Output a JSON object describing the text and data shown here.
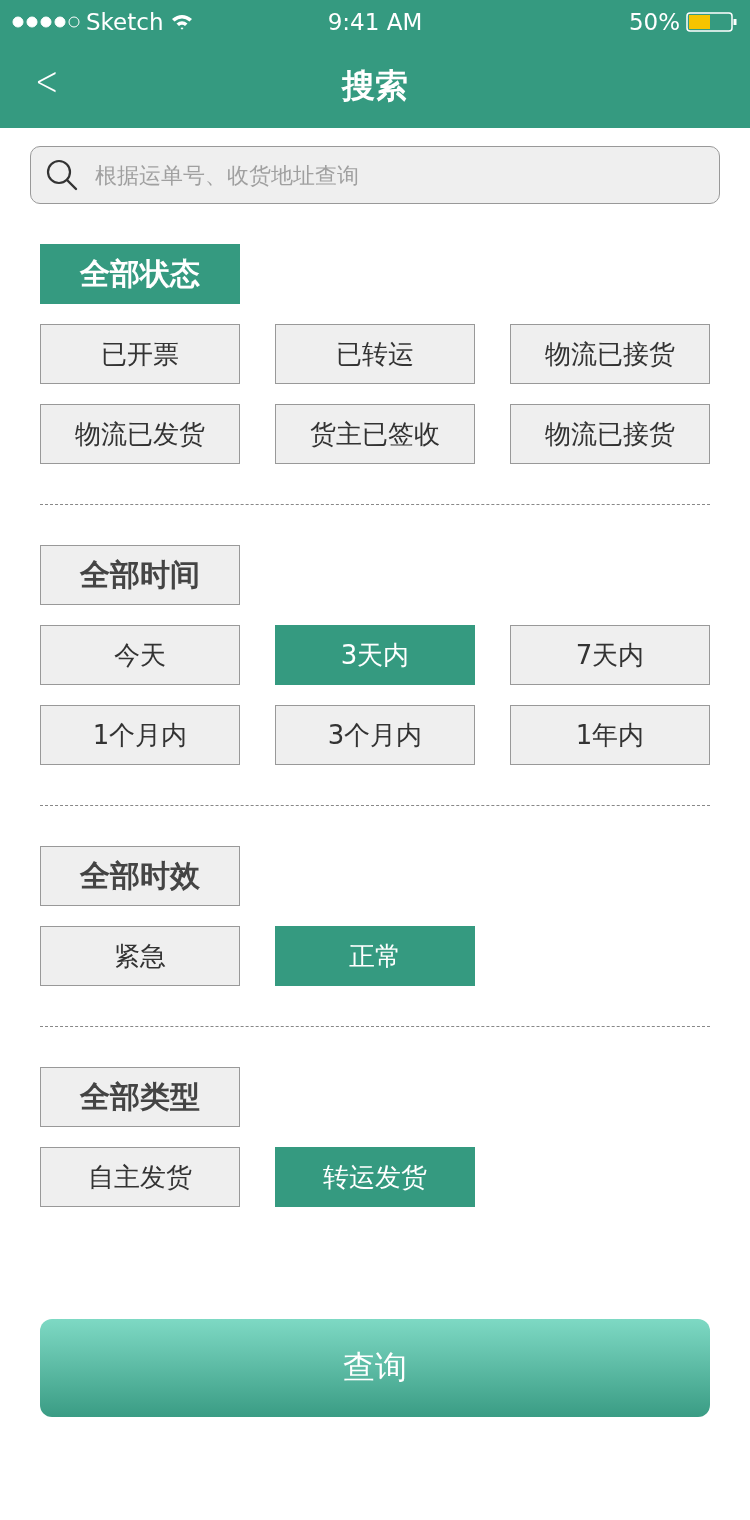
{
  "status_bar": {
    "carrier": "Sketch",
    "time": "9:41 AM",
    "battery": "50%"
  },
  "nav": {
    "back": "<",
    "title": "搜索"
  },
  "search": {
    "placeholder": "根据运单号、收货地址查询"
  },
  "sections": [
    {
      "header": {
        "label": "全部状态",
        "selected": true
      },
      "options": [
        {
          "label": "已开票",
          "selected": false
        },
        {
          "label": "已转运",
          "selected": false
        },
        {
          "label": "物流已接货",
          "selected": false
        },
        {
          "label": "物流已发货",
          "selected": false
        },
        {
          "label": "货主已签收",
          "selected": false
        },
        {
          "label": "物流已接货",
          "selected": false
        }
      ]
    },
    {
      "header": {
        "label": "全部时间",
        "selected": false
      },
      "options": [
        {
          "label": "今天",
          "selected": false
        },
        {
          "label": "3天内",
          "selected": true
        },
        {
          "label": "7天内",
          "selected": false
        },
        {
          "label": "1个月内",
          "selected": false
        },
        {
          "label": "3个月内",
          "selected": false
        },
        {
          "label": "1年内",
          "selected": false
        }
      ]
    },
    {
      "header": {
        "label": "全部时效",
        "selected": false
      },
      "options": [
        {
          "label": "紧急",
          "selected": false
        },
        {
          "label": "正常",
          "selected": true
        }
      ]
    },
    {
      "header": {
        "label": "全部类型",
        "selected": false
      },
      "options": [
        {
          "label": "自主发货",
          "selected": false
        },
        {
          "label": "转运发货",
          "selected": true
        }
      ]
    }
  ],
  "submit": "查询"
}
